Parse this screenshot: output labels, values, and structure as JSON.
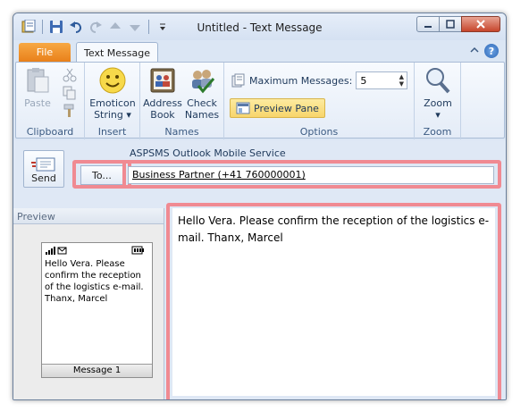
{
  "window": {
    "title": "Untitled - Text Message"
  },
  "tabs": {
    "file": "File",
    "active": "Text Message"
  },
  "ribbon": {
    "clipboard": {
      "paste": "Paste",
      "label": "Clipboard"
    },
    "insert": {
      "emoticon_line1": "Emoticon",
      "emoticon_line2": "String ▾",
      "label": "Insert"
    },
    "names": {
      "address_line1": "Address",
      "address_line2": "Book",
      "check_line1": "Check",
      "check_line2": "Names",
      "label": "Names"
    },
    "options": {
      "max_messages_label": "Maximum Messages:",
      "max_messages_value": "5",
      "preview_pane": "Preview Pane",
      "label": "Options"
    },
    "zoom": {
      "zoom": "Zoom",
      "label": "Zoom"
    }
  },
  "compose": {
    "service": "ASPSMS Outlook Mobile Service",
    "send": "Send",
    "to_button": "To...",
    "to_value": "Business Partner (+41 760000001)",
    "body": "Hello Vera. Please confirm the reception of the logistics e-mail. Thanx, Marcel"
  },
  "preview": {
    "header": "Preview",
    "text": "Hello Vera. Please confirm the reception of the logistics e-mail. Thanx, Marcel",
    "footer": "Message 1"
  },
  "colors": {
    "highlight": "#f08a92",
    "file_tab": "#e9801a",
    "preview_pane_bg": "#fdeba0"
  }
}
